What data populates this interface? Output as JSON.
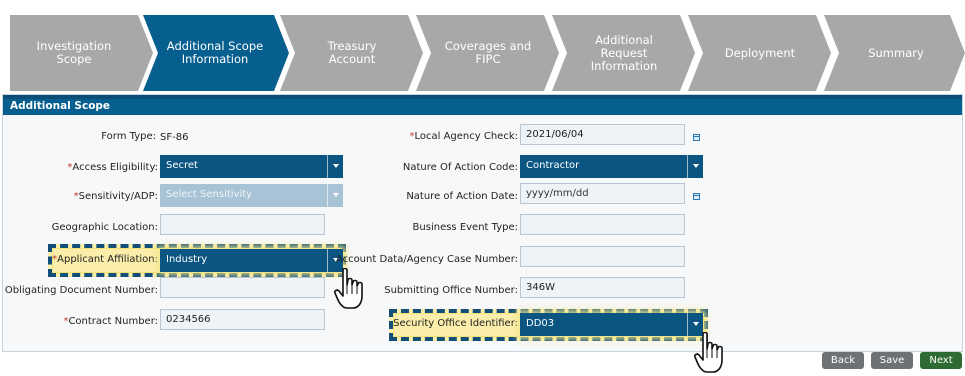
{
  "wizard": {
    "steps": [
      {
        "label": "Investigation\nScope",
        "state": "inactive"
      },
      {
        "label": "Additional Scope\nInformation",
        "state": "active"
      },
      {
        "label": "Treasury\nAccount",
        "state": "inactive"
      },
      {
        "label": "Coverages and\nFIPC",
        "state": "inactive"
      },
      {
        "label": "Additional\nRequest\nInformation",
        "state": "inactive"
      },
      {
        "label": "Deployment",
        "state": "inactive"
      },
      {
        "label": "Summary",
        "state": "inactive"
      }
    ],
    "colors": {
      "active": "#075f8f",
      "inactive": "#a8a8a8"
    }
  },
  "panel": {
    "title": "Additional Scope",
    "left": {
      "form_type": {
        "label": "Form Type:",
        "value": "SF-86"
      },
      "access_eligibility": {
        "label": "Access Eligibility:",
        "value": "Secret",
        "required": "*"
      },
      "sensitivity": {
        "label": "Sensitivity/ADP:",
        "value": "Select Sensitivity",
        "required": "*"
      },
      "geographic_location": {
        "label": "Geographic Location:",
        "value": ""
      },
      "applicant_affiliation": {
        "label": "Applicant Affiliation:",
        "value": "Industry",
        "required": "*"
      },
      "obligating_document": {
        "label": "Obligating Document Number:",
        "value": ""
      },
      "contract_number": {
        "label": "Contract Number:",
        "value": "0234566",
        "required": "*"
      }
    },
    "right": {
      "local_agency_check": {
        "label": "Local Agency Check:",
        "value": "2021/06/04",
        "required": "*"
      },
      "nature_of_action_code": {
        "label": "Nature Of Action Code:",
        "value": "Contractor"
      },
      "nature_of_action_date": {
        "label": "Nature of Action Date:",
        "value": "yyyy/mm/dd"
      },
      "business_event_type": {
        "label": "Business Event Type:",
        "value": ""
      },
      "account_data": {
        "label": "Account Data/Agency Case Number:",
        "value": ""
      },
      "submitting_office": {
        "label": "Submitting Office Number:",
        "value": "346W"
      },
      "security_office": {
        "label": "Security Office Identifier:",
        "value": "DD03"
      }
    }
  },
  "footer": {
    "back": "Back",
    "save": "Save",
    "next": "Next"
  },
  "icons": [
    "calendar-icon",
    "chevron-down-icon",
    "pointing-hand-icon"
  ]
}
